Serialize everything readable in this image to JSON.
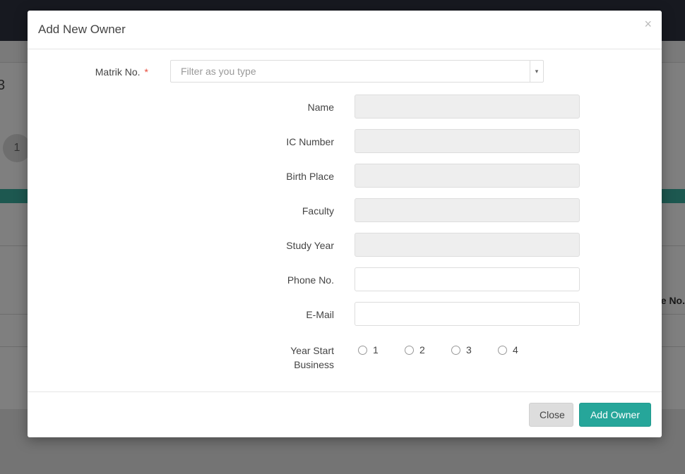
{
  "background": {
    "number": "3",
    "step_circle": "1",
    "column_header": "e No."
  },
  "modal": {
    "title": "Add New Owner",
    "close_icon": "×",
    "matrik": {
      "label": "Matrik No.",
      "required_mark": "*",
      "placeholder": "Filter as you type",
      "dropdown_icon": "▾"
    },
    "fields": [
      {
        "label": "Name",
        "value": "",
        "readonly": true
      },
      {
        "label": "IC Number",
        "value": "",
        "readonly": true
      },
      {
        "label": "Birth Place",
        "value": "",
        "readonly": true
      },
      {
        "label": "Faculty",
        "value": "",
        "readonly": true
      },
      {
        "label": "Study Year",
        "value": "",
        "readonly": true
      },
      {
        "label": "Phone No.",
        "value": "",
        "readonly": false
      },
      {
        "label": "E-Mail",
        "value": "",
        "readonly": false
      }
    ],
    "year_start": {
      "label_line1": "Year Start",
      "label_line2": "Business",
      "options": [
        "1",
        "2",
        "3",
        "4"
      ],
      "selected": null
    },
    "buttons": {
      "close": "Close",
      "add": "Add Owner"
    }
  },
  "colors": {
    "primary": "#26a69a",
    "required": "#e74c3c"
  }
}
